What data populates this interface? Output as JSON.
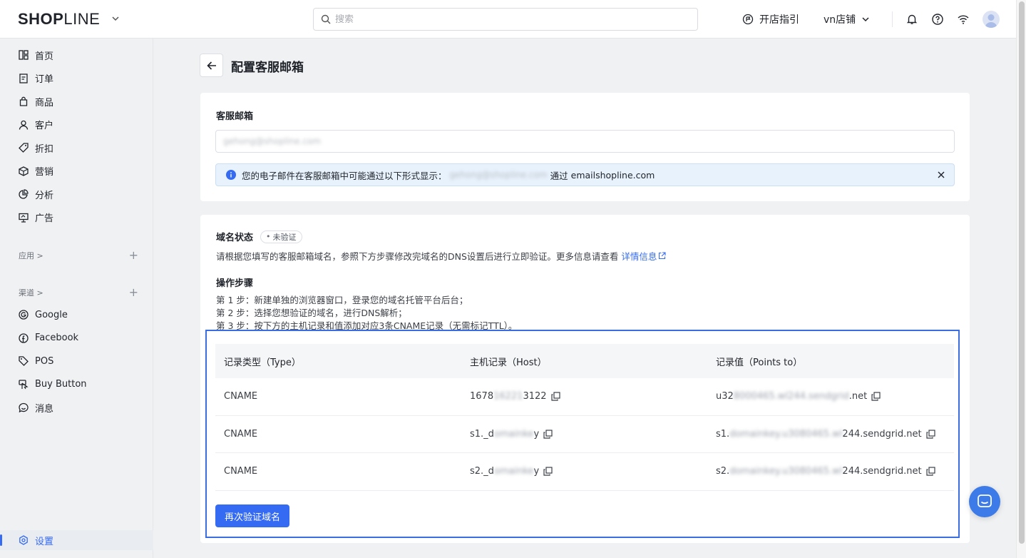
{
  "header": {
    "logo_bold": "SHOP",
    "logo_light": "LINE",
    "search_placeholder": "搜索",
    "guide_label": "开店指引",
    "store_name": "vn店铺"
  },
  "sidebar": {
    "items": [
      {
        "label": "首页",
        "icon": "dashboard-icon"
      },
      {
        "label": "订单",
        "icon": "order-icon"
      },
      {
        "label": "商品",
        "icon": "bag-icon"
      },
      {
        "label": "客户",
        "icon": "user-icon"
      },
      {
        "label": "折扣",
        "icon": "tag-icon"
      },
      {
        "label": "营销",
        "icon": "box-icon"
      },
      {
        "label": "分析",
        "icon": "pie-chart-icon"
      },
      {
        "label": "广告",
        "icon": "ad-icon"
      }
    ],
    "apps_label": "应用 >",
    "channels_label": "渠道 >",
    "channels": [
      {
        "label": "Google",
        "icon": "google-icon"
      },
      {
        "label": "Facebook",
        "icon": "facebook-icon"
      },
      {
        "label": "POS",
        "icon": "pos-tag-icon"
      },
      {
        "label": "Buy Button",
        "icon": "buy-button-icon"
      },
      {
        "label": "消息",
        "icon": "message-icon"
      }
    ],
    "settings_label": "设置"
  },
  "page": {
    "title": "配置客服邮箱",
    "email_label": "客服邮箱",
    "email_value": "gehong@shopline.com",
    "notice_prefix": "您的电子邮件在客服邮箱中可能通过以下形式显示：",
    "notice_blurred": "gehong@shopline.com",
    "notice_via": "通过",
    "notice_domain": "emailshopline.com",
    "domain_status_label": "域名状态",
    "domain_status_badge": "未验证",
    "description": "请根据您填写的客服邮箱域名，参照下方步骤修改完域名的DNS设置后进行立即验证。更多信息请查看",
    "details_link": "详情信息",
    "steps_title": "操作步骤",
    "steps": [
      "第 1 步：新建单独的浏览器窗口，登录您的域名托管平台后台；",
      "第 2 步：选择您想验证的域名，进行DNS解析；",
      "第 3 步：按下方的主机记录和值添加对应3条CNAME记录（无需标记TTL）。"
    ],
    "verify_button": "再次验证域名"
  },
  "dns_table": {
    "headers": [
      "记录类型（Type）",
      "主机记录（Host）",
      "记录值（Points to）"
    ],
    "rows": [
      {
        "type": "CNAME",
        "host_a": "1678",
        "host_b": "16221",
        "host_c": "3122",
        "val_a": "u32",
        "val_b": "8000465.wl244.sendgrid",
        "val_c": ".net"
      },
      {
        "type": "CNAME",
        "host_a": "s1._d",
        "host_b": "omainke",
        "host_c": "y",
        "val_a": "s1.",
        "val_b": "domainkey.u3080465.wl",
        "val_c": "244.sendgrid.net"
      },
      {
        "type": "CNAME",
        "host_a": "s2._d",
        "host_b": "omainke",
        "host_c": "y",
        "val_a": "s2.",
        "val_b": "domainkey.u3080465.wl",
        "val_c": "244.sendgrid.net"
      }
    ]
  },
  "colors": {
    "accent": "#356bf2",
    "notice_bg": "#e8f2fd",
    "highlight_border": "#3a6ee0"
  }
}
